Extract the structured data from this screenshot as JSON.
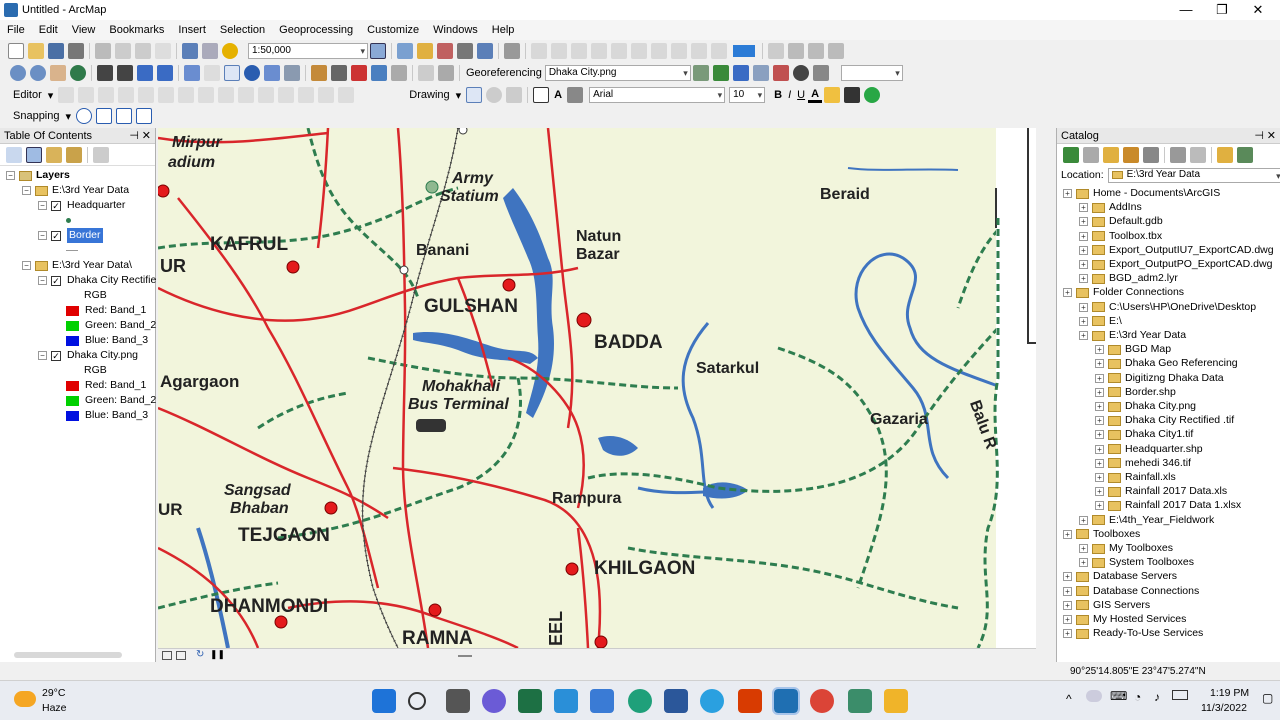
{
  "window": {
    "title": "Untitled - ArcMap"
  },
  "menu": [
    "File",
    "Edit",
    "View",
    "Bookmarks",
    "Insert",
    "Selection",
    "Geoprocessing",
    "Customize",
    "Windows",
    "Help"
  ],
  "toolbar": {
    "scale": "1:50,000",
    "georeferencing_label": "Georeferencing",
    "georef_layer": "Dhaka City.png",
    "editor_label": "Editor",
    "drawing_label": "Drawing",
    "font_name": "Arial",
    "font_size": "10",
    "snapping_label": "Snapping",
    "bold": "B",
    "italic": "I",
    "underline": "U"
  },
  "toc": {
    "title": "Table Of Contents",
    "layers_label": "Layers",
    "group1": "E:\\3rd Year Data",
    "headquarter": "Headquarter",
    "border": "Border",
    "group2": "E:\\3rd Year Data\\",
    "rectified": "Dhaka City Rectifie",
    "rgb1": "RGB",
    "red1": "Red:   Band_1",
    "green1": "Green: Band_2",
    "blue1": "Blue:   Band_3",
    "png": "Dhaka City.png",
    "rgb2": "RGB",
    "red2": "Red:   Band_1",
    "green2": "Green: Band_2",
    "blue2": "Blue:   Band_3"
  },
  "map_labels": {
    "mirpur": "Mirpur",
    "stadium": "adium",
    "ur": "UR",
    "kafrul": "KAFRUL",
    "army": "Army",
    "statium": "Statium",
    "banani": "Banani",
    "natun": "Natun",
    "bazar": "Bazar",
    "gulshan": "GULSHAN",
    "badda": "BADDA",
    "agargaon": "Agargaon",
    "mohakhali": "Mohakhali",
    "bus_terminal": "Bus Terminal",
    "satarkul": "Satarkul",
    "beraid": "Beraid",
    "gazaria": "Gazaria",
    "balu": "Balu R",
    "rampura": "Rampura",
    "sangsad": "Sangsad",
    "bhaban": "Bhaban",
    "ur2": "UR",
    "tejgaon": "TEJGAON",
    "khilgaon": "KHILGAON",
    "dhanmondi": "DHANMONDI",
    "ramna": "RAMNA",
    "eel": "EEL"
  },
  "catalog": {
    "title": "Catalog",
    "location_label": "Location:",
    "location_value": "E:\\3rd Year Data",
    "items": [
      {
        "label": "Home - Documents\\ArcGIS",
        "indent": 0
      },
      {
        "label": "AddIns",
        "indent": 1
      },
      {
        "label": "Default.gdb",
        "indent": 1
      },
      {
        "label": "Toolbox.tbx",
        "indent": 1
      },
      {
        "label": "Export_OutputIU7_ExportCAD.dwg",
        "indent": 1
      },
      {
        "label": "Export_OutputPO_ExportCAD.dwg",
        "indent": 1
      },
      {
        "label": "BGD_adm2.lyr",
        "indent": 1
      },
      {
        "label": "Folder Connections",
        "indent": 0
      },
      {
        "label": "C:\\Users\\HP\\OneDrive\\Desktop",
        "indent": 1
      },
      {
        "label": "E:\\",
        "indent": 1
      },
      {
        "label": "E:\\3rd Year Data",
        "indent": 1
      },
      {
        "label": "BGD Map",
        "indent": 2
      },
      {
        "label": "Dhaka Geo Referencing",
        "indent": 2
      },
      {
        "label": "Digitizng Dhaka Data",
        "indent": 2
      },
      {
        "label": "Border.shp",
        "indent": 2
      },
      {
        "label": "Dhaka City.png",
        "indent": 2
      },
      {
        "label": "Dhaka City Rectified .tif",
        "indent": 2
      },
      {
        "label": "Dhaka City1.tif",
        "indent": 2
      },
      {
        "label": "Headquarter.shp",
        "indent": 2
      },
      {
        "label": "mehedi 346.tif",
        "indent": 2
      },
      {
        "label": "Rainfall.xls",
        "indent": 2
      },
      {
        "label": "Rainfall 2017 Data.xls",
        "indent": 2
      },
      {
        "label": "Rainfall 2017 Data 1.xlsx",
        "indent": 2
      },
      {
        "label": "E:\\4th_Year_Fieldwork",
        "indent": 1
      },
      {
        "label": "Toolboxes",
        "indent": 0
      },
      {
        "label": "My Toolboxes",
        "indent": 1
      },
      {
        "label": "System Toolboxes",
        "indent": 1
      },
      {
        "label": "Database Servers",
        "indent": 0
      },
      {
        "label": "Database Connections",
        "indent": 0
      },
      {
        "label": "GIS Servers",
        "indent": 0
      },
      {
        "label": "My Hosted Services",
        "indent": 0
      },
      {
        "label": "Ready-To-Use Services",
        "indent": 0
      }
    ]
  },
  "status": {
    "coords": "90°25'14.805\"E  23°47'5.274\"N"
  },
  "taskbar": {
    "temp": "29°C",
    "weather": "Haze",
    "time": "1:19 PM",
    "date": "11/3/2022"
  },
  "colors": {
    "river": "#3f74c0",
    "road": "#d9262b",
    "border": "#2e7d4f",
    "map_bg": "#f2f5dc"
  }
}
